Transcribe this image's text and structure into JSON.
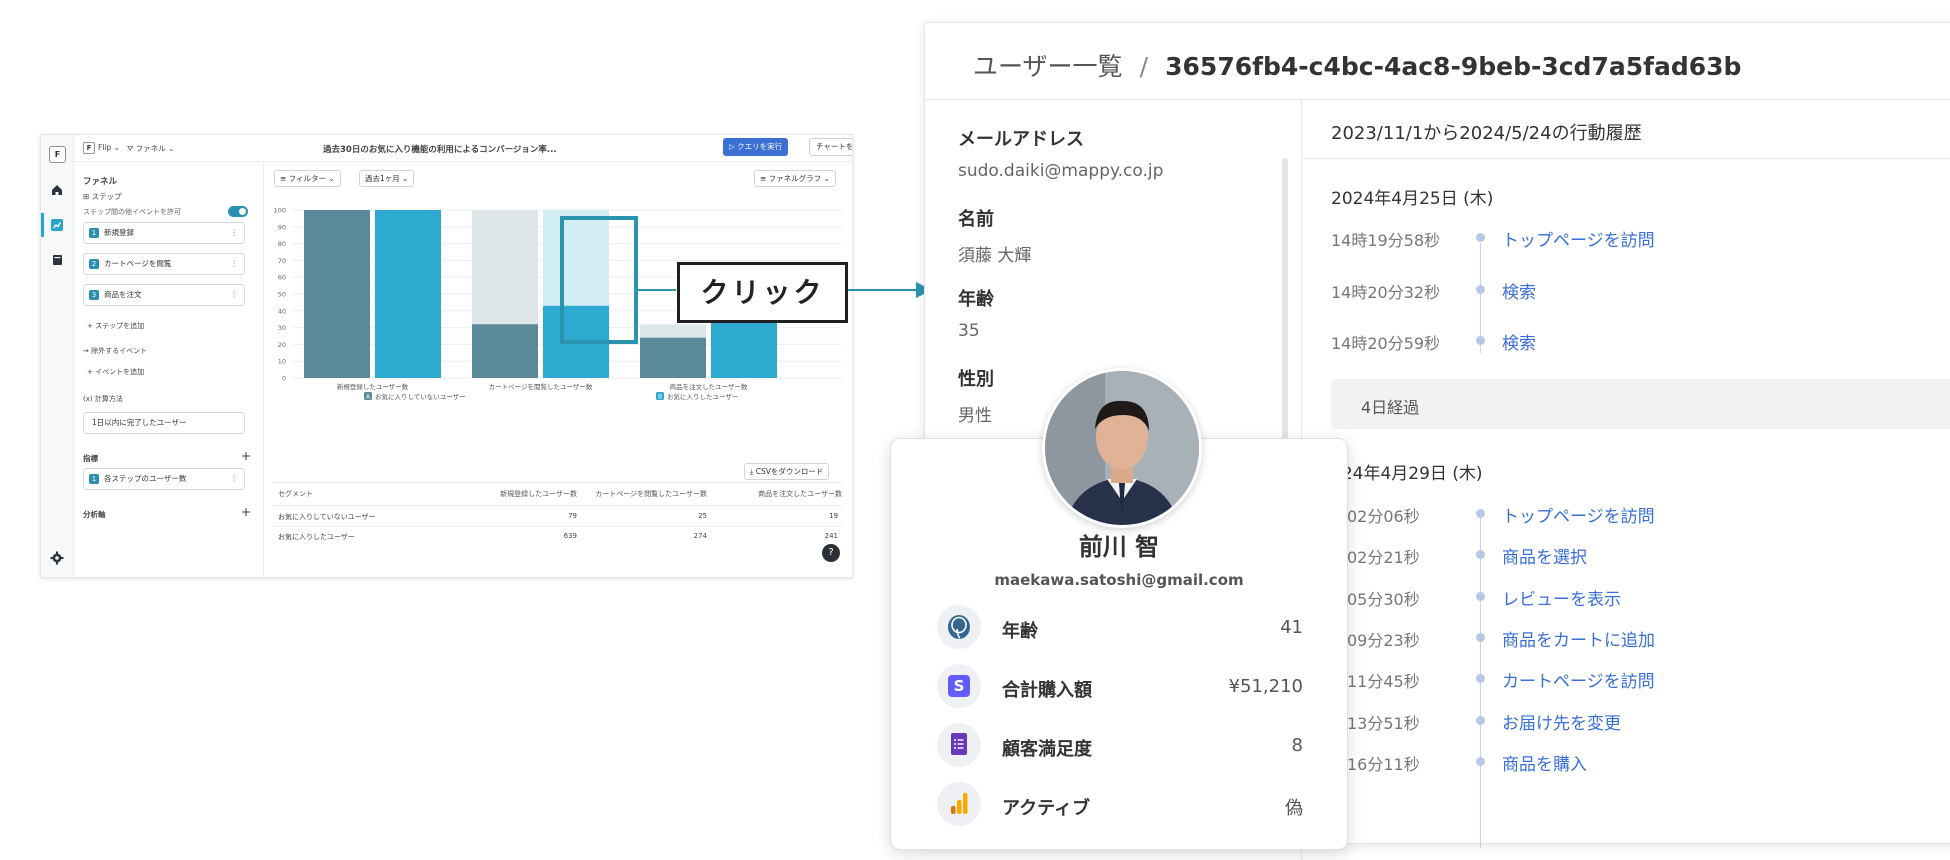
{
  "app": {
    "rail_logo": "F",
    "top": {
      "project_badge": "F",
      "project": "Flip",
      "funnel_menu": "ファネル",
      "chart_title": "過去30日のお気に入り機能の利用によるコンバージョン率...",
      "run_query": "クエリを実行",
      "save_chart": "チャートを保存"
    },
    "side": {
      "funnel_heading": "ファネル",
      "steps_heading": "ステップ",
      "allow_other_events": "ステップ間の他イベントを許可",
      "steps": [
        {
          "num": "1",
          "label": "新規登録"
        },
        {
          "num": "2",
          "label": "カートページを閲覧"
        },
        {
          "num": "3",
          "label": "商品を注文"
        }
      ],
      "add_step": "ステップを追加",
      "exclude_heading": "除外するイベント",
      "add_event": "イベントを追加",
      "calc_heading": "計算方法",
      "calc_value": "1日以内に完了したユーザー",
      "metric_heading": "指標",
      "metric_item_num": "1",
      "metric_item": "各ステップのユーザー数",
      "axis_heading": "分析軸"
    },
    "toolbar": {
      "filter": "フィルター",
      "period": "過去1ヶ月",
      "graph_type": "ファネルグラフ",
      "csv_download": "CSVをダウンロード"
    },
    "table": {
      "headers": [
        "セグメント",
        "新規登録したユーザー数",
        "カートページを閲覧したユーザー数",
        "商品を注文したユーザー数"
      ],
      "rows": [
        [
          "お気に入りしていないユーザー",
          "79",
          "25",
          "19"
        ],
        [
          "お気に入りしたユーザー",
          "639",
          "274",
          "241"
        ]
      ]
    },
    "help": "?"
  },
  "chart_data": {
    "type": "bar",
    "categories": [
      "新規登録したユーザー数",
      "カートページを閲覧したユーザー数",
      "商品を注文したユーザー数"
    ],
    "series": [
      {
        "name": "お気に入りしていないユーザー",
        "badge": "A",
        "values": [
          100,
          32,
          24
        ],
        "color": "#5a8a9a"
      },
      {
        "name": "お気に入りしたユーザー",
        "badge": "B",
        "values": [
          100,
          43,
          38
        ],
        "color": "#2eaad1"
      }
    ],
    "y_ticks": [
      "0",
      "10",
      "20",
      "30",
      "40",
      "50",
      "60",
      "70",
      "80",
      "90",
      "100"
    ],
    "ylim": [
      0,
      100
    ],
    "grid": true,
    "legend": "bottom"
  },
  "callout": {
    "label": "クリック"
  },
  "detail": {
    "breadcrumb_parent": "ユーザー一覧",
    "separator": "/",
    "user_id": "36576fb4-c4bc-4ac8-9beb-3cd7a5fad63b",
    "fields": [
      {
        "label": "メールアドレス",
        "value": "sudo.daiki@mappy.co.jp"
      },
      {
        "label": "名前",
        "value": "須藤 大輝"
      },
      {
        "label": "年齢",
        "value": "35"
      },
      {
        "label": "性別",
        "value": "男性"
      }
    ],
    "history_title": "2023/11/1から2024/5/24の行動履歴",
    "day1": {
      "date": "2024年4月25日 (木)",
      "events": [
        {
          "time": "14時19分58秒",
          "action": "トップページを訪問"
        },
        {
          "time": "14時20分32秒",
          "action": "検索"
        },
        {
          "time": "14時20分59秒",
          "action": "検索"
        }
      ]
    },
    "gap_label": "4日経過",
    "day2": {
      "date": "024年4月29日 (木)",
      "events": [
        {
          "time": "時02分06秒",
          "action": "トップページを訪問"
        },
        {
          "time": "時02分21秒",
          "action": "商品を選択"
        },
        {
          "time": "時05分30秒",
          "action": "レビューを表示"
        },
        {
          "time": "時09分23秒",
          "action": "商品をカートに追加"
        },
        {
          "time": "時11分45秒",
          "action": "カートページを訪問"
        },
        {
          "time": "時13分51秒",
          "action": "お届け先を変更"
        },
        {
          "time": "時16分11秒",
          "action": "商品を購入"
        }
      ]
    }
  },
  "profile": {
    "name": "前川 智",
    "email": "maekawa.satoshi@gmail.com",
    "rows": [
      {
        "icon": "postgres-icon",
        "label": "年齢",
        "value": "41"
      },
      {
        "icon": "stripe-icon",
        "label": "合計購入額",
        "value": "¥51,210"
      },
      {
        "icon": "forms-icon",
        "label": "顧客満足度",
        "value": "8"
      },
      {
        "icon": "analytics-icon",
        "label": "アクティブ",
        "value": "偽"
      }
    ],
    "icon_letters": {
      "stripe": "S"
    }
  },
  "colors": {
    "accent": "#2aa6c8",
    "primary_button": "#3b6fd4",
    "link": "#3a6fd8",
    "bar_a": "#5a8a9a",
    "bar_b": "#2eaad1"
  }
}
